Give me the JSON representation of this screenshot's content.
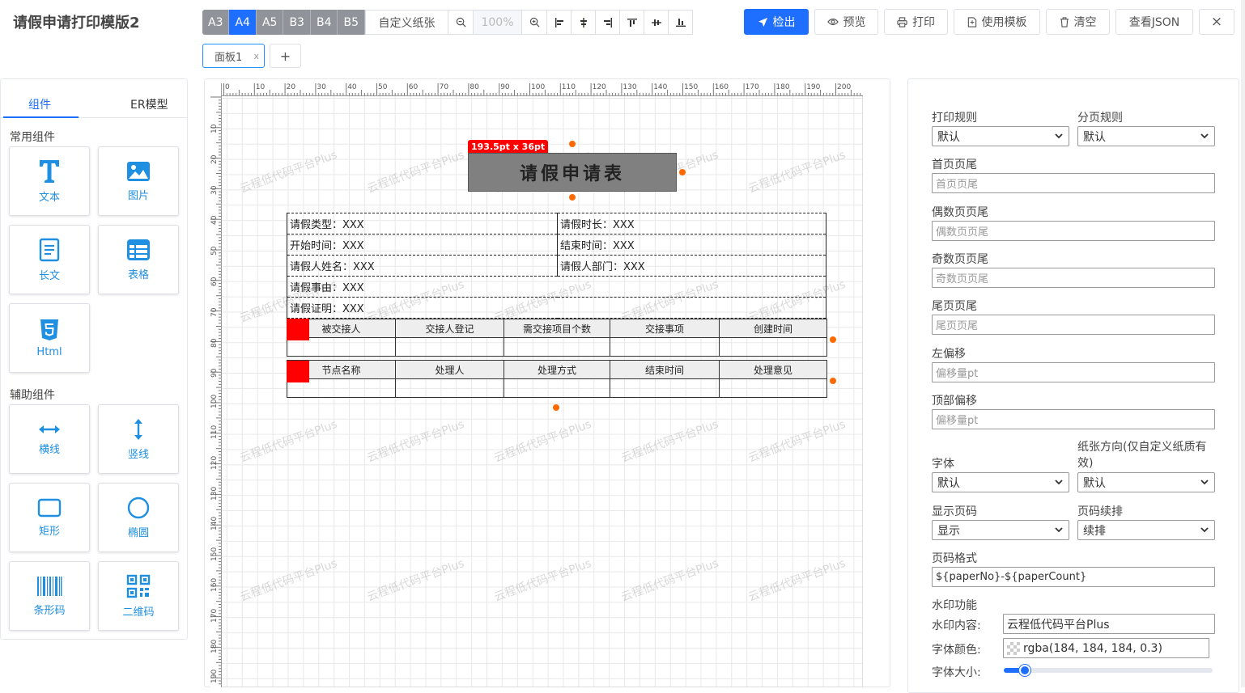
{
  "app": {
    "title": "请假申请打印模版2"
  },
  "toolbar": {
    "paper_sizes": [
      "A3",
      "A4",
      "A5",
      "B3",
      "B4",
      "B5"
    ],
    "active_paper": "A4",
    "custom_paper": "自定义纸张",
    "zoom": "100%"
  },
  "actions": {
    "check": "检出",
    "preview": "预览",
    "print": "打印",
    "use_template": "使用模板",
    "clear": "清空",
    "view_json": "查看JSON",
    "close": "×"
  },
  "panels": {
    "tab_label": "面板1",
    "tab_close": "x",
    "add": "+"
  },
  "left": {
    "tabs": [
      "组件",
      "ER模型"
    ],
    "group_common": "常用组件",
    "group_aux": "辅助组件",
    "common": [
      {
        "label": "文本",
        "icon": "text-icon"
      },
      {
        "label": "图片",
        "icon": "image-icon"
      },
      {
        "label": "长文",
        "icon": "longtext-icon"
      },
      {
        "label": "表格",
        "icon": "table-icon"
      },
      {
        "label": "Html",
        "icon": "html5-icon"
      }
    ],
    "aux": [
      {
        "label": "横线",
        "icon": "hline-icon"
      },
      {
        "label": "竖线",
        "icon": "vline-icon"
      },
      {
        "label": "矩形",
        "icon": "rect-icon"
      },
      {
        "label": "椭圆",
        "icon": "ellipse-icon"
      },
      {
        "label": "条形码",
        "icon": "barcode-icon"
      },
      {
        "label": "二维码",
        "icon": "qrcode-icon"
      }
    ]
  },
  "ruler": {
    "h": [
      "0",
      "10",
      "20",
      "30",
      "40",
      "50",
      "60",
      "70",
      "80",
      "90",
      "100",
      "110",
      "120",
      "130",
      "140",
      "150",
      "160",
      "170",
      "180",
      "190",
      "200"
    ],
    "v": [
      "10",
      "20",
      "30",
      "40",
      "50",
      "60",
      "70",
      "80",
      "90",
      "100",
      "110",
      "120",
      "130",
      "140",
      "150",
      "160",
      "170",
      "180",
      "190"
    ]
  },
  "canvas": {
    "size_tag": "193.5pt x 36pt",
    "doc_title": "请假申请表",
    "watermark": "云程低代码平台Plus",
    "form_rows": [
      [
        "请假类型：XXX",
        "请假时长：XXX"
      ],
      [
        "开始时间：XXX",
        "结束时间：XXX"
      ],
      [
        "请假人姓名：XXX",
        "请假人部门：XXX"
      ],
      [
        "请假事由：XXX"
      ],
      [
        "请假证明：XXX"
      ]
    ],
    "table1_headers": [
      "被交接人",
      "交接人登记",
      "需交接项目个数",
      "交接事项",
      "创建时间"
    ],
    "table2_headers": [
      "节点名称",
      "处理人",
      "处理方式",
      "结束时间",
      "处理意见"
    ]
  },
  "right": {
    "print_rule_label": "打印规则",
    "print_rule_value": "默认",
    "page_rule_label": "分页规则",
    "page_rule_value": "默认",
    "first_footer_label": "首页页尾",
    "first_footer_placeholder": "首页页尾",
    "even_footer_label": "偶数页页尾",
    "even_footer_placeholder": "偶数页页尾",
    "odd_footer_label": "奇数页页尾",
    "odd_footer_placeholder": "奇数页页尾",
    "last_footer_label": "尾页页尾",
    "last_footer_placeholder": "尾页页尾",
    "left_offset_label": "左偏移",
    "left_offset_placeholder": "偏移量pt",
    "top_offset_label": "顶部偏移",
    "top_offset_placeholder": "偏移量pt",
    "font_label": "字体",
    "font_value": "默认",
    "orientation_label": "纸张方向(仅自定义纸质有效)",
    "orientation_value": "默认",
    "show_page_label": "显示页码",
    "show_page_value": "显示",
    "page_cont_label": "页码续排",
    "page_cont_value": "续排",
    "page_format_label": "页码格式",
    "page_format_value": "${paperNo}-${paperCount}",
    "watermark_section": "水印功能",
    "watermark_content_label": "水印内容:",
    "watermark_content_value": "云程低代码平台Plus",
    "font_color_label": "字体颜色:",
    "font_color_value": "rgba(184, 184, 184, 0.3)",
    "font_size_label": "字体大小:",
    "font_size_level": 0.1
  },
  "colors": {
    "primary": "#1e6fff",
    "paper_btn": "#909399",
    "handle": "#ff6a00",
    "header_fill": "#808080"
  }
}
